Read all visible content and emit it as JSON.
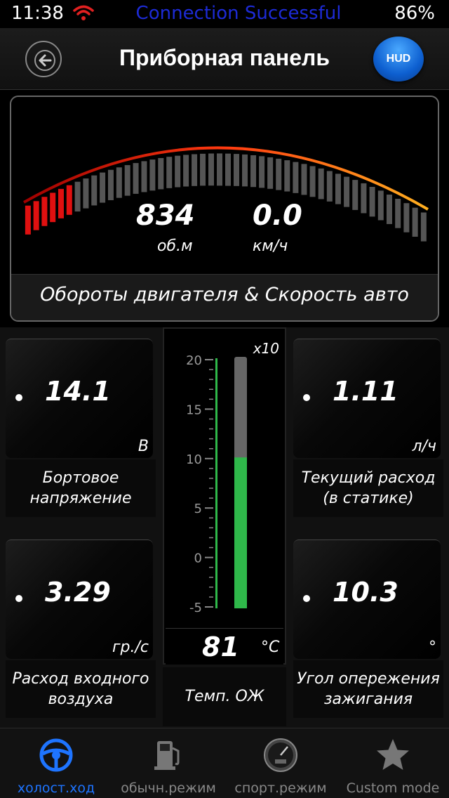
{
  "status_bar": {
    "time": "11:38",
    "connection": "Connection Successful",
    "battery": "86%"
  },
  "header": {
    "title": "Приборная панель",
    "hud_label": "HUD"
  },
  "main_gauge": {
    "rpm_value": "834",
    "rpm_unit": "об.м",
    "speed_value": "0.0",
    "speed_unit": "км/ч",
    "label": "Обороты двигателя & Скорость авто",
    "rpm_fill_fraction": 0.12
  },
  "tiles": {
    "voltage": {
      "value": "14.1",
      "unit": "В",
      "label_line1": "Бортовое",
      "label_line2": "напряжение"
    },
    "consumption": {
      "value": "1.11",
      "unit": "л/ч",
      "label_line1": "Текущий расход",
      "label_line2": "(в статике)"
    },
    "airflow": {
      "value": "3.29",
      "unit": "гр./с",
      "label_line1": "Расход входного",
      "label_line2": "воздуха"
    },
    "ignition": {
      "value": "10.3",
      "unit": "°",
      "label_line1": "Угол опережения",
      "label_line2": "зажигания"
    }
  },
  "coolant": {
    "multiplier": "x10",
    "scale": [
      "20",
      "15",
      "10",
      "5",
      "0",
      "-5"
    ],
    "value": "81",
    "unit": "°C",
    "label": "Темп. ОЖ",
    "fill_fraction": 0.6
  },
  "tabs": [
    {
      "label": "холост.ход",
      "icon": "steering-wheel-icon",
      "active": true
    },
    {
      "label": "обычн.режим",
      "icon": "fuel-pump-icon",
      "active": false
    },
    {
      "label": "спорт.режим",
      "icon": "speedometer-icon",
      "active": false
    },
    {
      "label": "Custom mode",
      "icon": "star-icon",
      "active": false
    }
  ],
  "colors": {
    "accent": "#1e74ff",
    "connection_text": "#1d2bd6",
    "rpm_active": "#e01010",
    "thermo_green": "#2fb84a"
  }
}
